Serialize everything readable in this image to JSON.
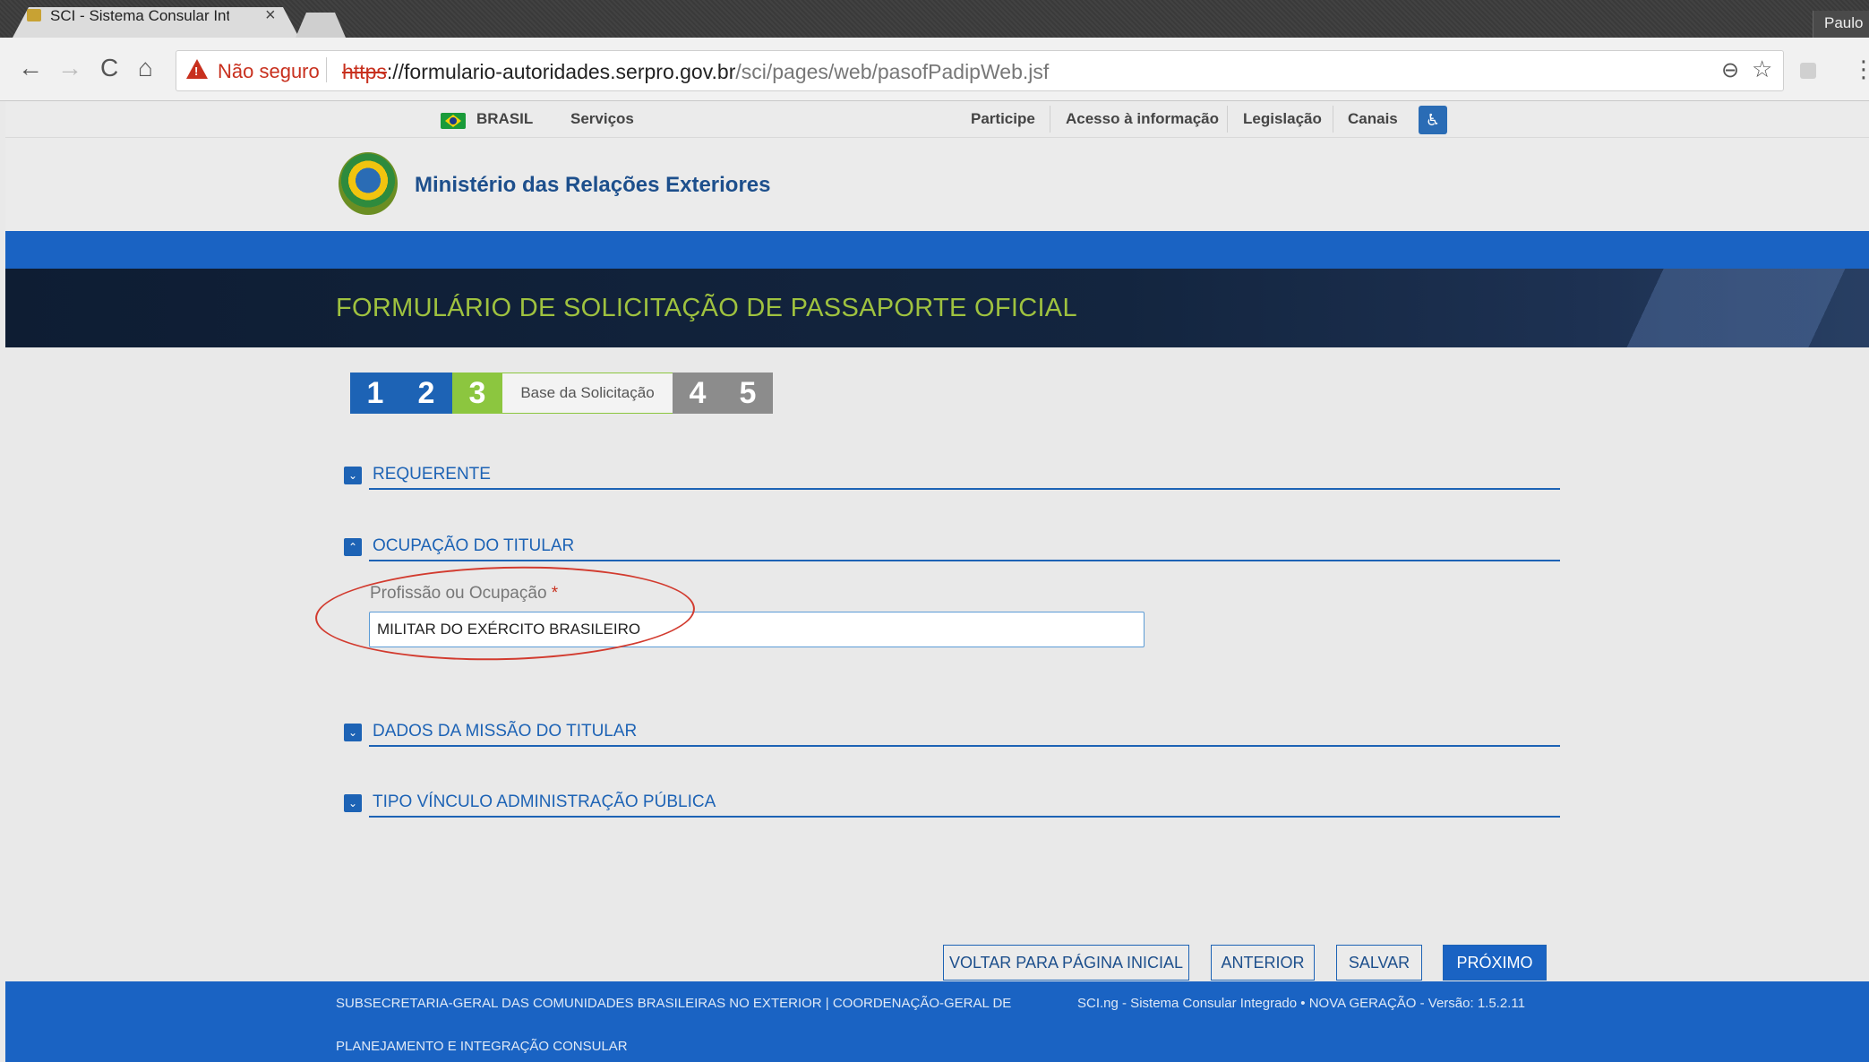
{
  "browser": {
    "tab_title": "SCI - Sistema Consular Inte",
    "tab_close": "×",
    "profile_name": "Paulo",
    "security_label": "Não seguro",
    "url_protocol": "https",
    "url_host": "://formulario-autoridades.serpro.gov.br",
    "url_path": "/sci/pages/web/pasofPadipWeb.jsf",
    "nav_back": "←",
    "nav_forward": "→",
    "nav_reload": "C",
    "nav_home": "⌂",
    "zoom_glyph": "⊖",
    "star_glyph": "☆",
    "menu_glyph": "⋮"
  },
  "govbar": {
    "brasil": "BRASIL",
    "servicos": "Serviços",
    "participe": "Participe",
    "acesso": "Acesso à informação",
    "legislacao": "Legislação",
    "canais": "Canais",
    "accessibility_glyph": "♿"
  },
  "header": {
    "ministry": "Ministério das Relações Exteriores",
    "form_title": "FORMULÁRIO DE SOLICITAÇÃO DE PASSAPORTE OFICIAL"
  },
  "steps": {
    "s1": "1",
    "s2": "2",
    "s3": "3",
    "current_label": "Base da Solicitação",
    "s4": "4",
    "s5": "5",
    "current_step": 3
  },
  "sections": {
    "requerente": "REQUERENTE",
    "ocupacao": "OCUPAÇÃO DO TITULAR",
    "missao": "DADOS DA MISSÃO DO TITULAR",
    "vinculo": "TIPO VÍNCULO ADMINISTRAÇÃO PÚBLICA",
    "collapsed_glyph": "⌄",
    "expanded_glyph": "⌃"
  },
  "form": {
    "occupation_label": "Profissão ou Ocupação",
    "required_mark": "*",
    "occupation_value": "MILITAR DO EXÉRCITO BRASILEIRO"
  },
  "buttons": {
    "voltar": "VOLTAR PARA PÁGINA INICIAL",
    "anterior": "ANTERIOR",
    "salvar": "SALVAR",
    "proximo": "PRÓXIMO"
  },
  "footer": {
    "org_line1": "SUBSECRETARIA-GERAL DAS COMUNIDADES BRASILEIRAS NO EXTERIOR | COORDENAÇÃO-GERAL DE",
    "org_line2": "PLANEJAMENTO E INTEGRAÇÃO CONSULAR",
    "version": "SCI.ng - Sistema Consular Integrado • NOVA GERAÇÃO - Versão: 1.5.2.11"
  },
  "colors": {
    "gov_blue": "#1a63c3",
    "banner_dark": "#0e1d33",
    "title_green": "#9fc23f",
    "step_green": "#8cc63f",
    "step_gray": "#8c8c8c",
    "annotation_red": "#d23b2f"
  }
}
